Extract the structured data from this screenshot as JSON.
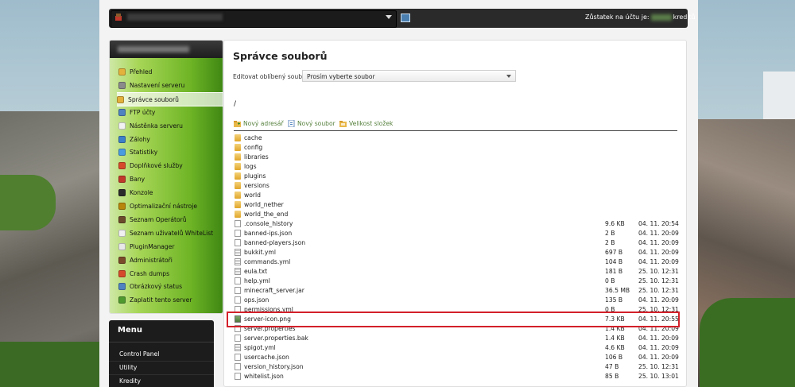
{
  "header": {
    "server_selector": {
      "value": "",
      "icon": "server-icon"
    },
    "balance_label": "Zůstatek na účtu je:",
    "balance_suffix": "kreditů"
  },
  "sidebar": {
    "items": [
      {
        "label": "Přehled",
        "icon": "overview-icon",
        "color": "#e3b23c"
      },
      {
        "label": "Nastavení serveru",
        "icon": "wrench-icon",
        "color": "#8a8a8a"
      },
      {
        "label": "Správce souborů",
        "icon": "folder-icon",
        "color": "#e3b23c",
        "active": true
      },
      {
        "label": "FTP účty",
        "icon": "ftp-icon",
        "color": "#4f82c0"
      },
      {
        "label": "Nástěnka serveru",
        "icon": "board-icon",
        "color": "#f2f2f2"
      },
      {
        "label": "Zálohy",
        "icon": "backup-icon",
        "color": "#3d7fc9"
      },
      {
        "label": "Statistiky",
        "icon": "chart-icon",
        "color": "#4a9be0"
      },
      {
        "label": "Doplňkové služby",
        "icon": "gift-icon",
        "color": "#d64a2b"
      },
      {
        "label": "Bany",
        "icon": "ban-icon",
        "color": "#c0392b"
      },
      {
        "label": "Konzole",
        "icon": "console-icon",
        "color": "#2b2b2b"
      },
      {
        "label": "Optimalizační nástroje",
        "icon": "tools-icon",
        "color": "#b8860b"
      },
      {
        "label": "Seznam Operátorů",
        "icon": "operators-icon",
        "color": "#6b4a2b"
      },
      {
        "label": "Seznam uživatelů WhiteList",
        "icon": "whitelist-icon",
        "color": "#f0f0f0"
      },
      {
        "label": "PluginManager",
        "icon": "plugin-icon",
        "color": "#e8e8e8"
      },
      {
        "label": "Administrátoři",
        "icon": "admin-icon",
        "color": "#7b4a2b"
      },
      {
        "label": "Crash dumps",
        "icon": "crash-icon",
        "color": "#d64a2b"
      },
      {
        "label": "Obrázkový status",
        "icon": "image-status-icon",
        "color": "#4f82c0"
      },
      {
        "label": "Zaplatit tento server",
        "icon": "pay-icon",
        "color": "#4f9a2f"
      }
    ]
  },
  "menu2": {
    "title": "Menu",
    "items": [
      "Control Panel",
      "Utility",
      "Kredity"
    ]
  },
  "main": {
    "title": "Správce souborů",
    "favorite_label": "Editovat oblíbený soubor",
    "favorite_select": "Prosím vyberte soubor",
    "path": "/",
    "toolbar": [
      {
        "label": "Nový adresář",
        "icon": "new-folder-icon"
      },
      {
        "label": "Nový soubor",
        "icon": "new-file-icon"
      },
      {
        "label": "Velikost složek",
        "icon": "folder-size-icon"
      }
    ],
    "files": [
      {
        "name": "cache",
        "type": "folder",
        "size": "",
        "date": ""
      },
      {
        "name": "config",
        "type": "folder",
        "size": "",
        "date": ""
      },
      {
        "name": "libraries",
        "type": "folder",
        "size": "",
        "date": ""
      },
      {
        "name": "logs",
        "type": "folder",
        "size": "",
        "date": ""
      },
      {
        "name": "plugins",
        "type": "folder",
        "size": "",
        "date": ""
      },
      {
        "name": "versions",
        "type": "folder",
        "size": "",
        "date": ""
      },
      {
        "name": "world",
        "type": "folder",
        "size": "",
        "date": ""
      },
      {
        "name": "world_nether",
        "type": "folder",
        "size": "",
        "date": ""
      },
      {
        "name": "world_the_end",
        "type": "folder",
        "size": "",
        "date": ""
      },
      {
        "name": ".console_history",
        "type": "file",
        "size": "9.6 KB",
        "date": "04. 11. 20:54"
      },
      {
        "name": "banned-ips.json",
        "type": "file",
        "size": "2 B",
        "date": "04. 11. 20:09"
      },
      {
        "name": "banned-players.json",
        "type": "file",
        "size": "2 B",
        "date": "04. 11. 20:09"
      },
      {
        "name": "bukkit.yml",
        "type": "text",
        "size": "697 B",
        "date": "04. 11. 20:09"
      },
      {
        "name": "commands.yml",
        "type": "text",
        "size": "104 B",
        "date": "04. 11. 20:09"
      },
      {
        "name": "eula.txt",
        "type": "text",
        "size": "181 B",
        "date": "25. 10. 12:31"
      },
      {
        "name": "help.yml",
        "type": "file",
        "size": "0 B",
        "date": "25. 10. 12:31"
      },
      {
        "name": "minecraft_server.jar",
        "type": "file",
        "size": "36.5 MB",
        "date": "25. 10. 12:31"
      },
      {
        "name": "ops.json",
        "type": "file",
        "size": "135 B",
        "date": "04. 11. 20:09"
      },
      {
        "name": "permissions.yml",
        "type": "file",
        "size": "0 B",
        "date": "25. 10. 12:31"
      },
      {
        "name": "server-icon.png",
        "type": "image",
        "size": "7.3 KB",
        "date": "04. 11. 20:55",
        "highlighted": true
      },
      {
        "name": "server.properties",
        "type": "file",
        "size": "1.4 KB",
        "date": "04. 11. 20:09"
      },
      {
        "name": "server.properties.bak",
        "type": "file",
        "size": "1.4 KB",
        "date": "04. 11. 20:09"
      },
      {
        "name": "spigot.yml",
        "type": "text",
        "size": "4.6 KB",
        "date": "04. 11. 20:09"
      },
      {
        "name": "usercache.json",
        "type": "file",
        "size": "106 B",
        "date": "04. 11. 20:09"
      },
      {
        "name": "version_history.json",
        "type": "file",
        "size": "47 B",
        "date": "25. 10. 12:31"
      },
      {
        "name": "whitelist.json",
        "type": "file",
        "size": "85 B",
        "date": "25. 10. 13:01"
      }
    ]
  },
  "colors": {
    "accent_green": "#6fb526",
    "highlight": "#d3202a",
    "link_green": "#55803c"
  }
}
